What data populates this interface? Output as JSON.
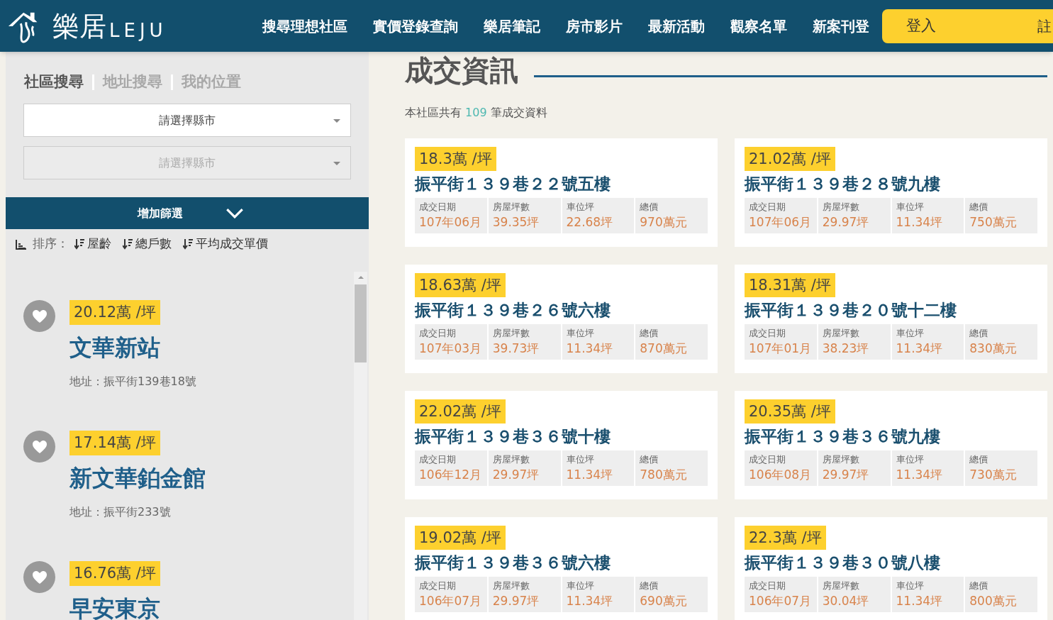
{
  "header": {
    "logo_text": "樂居",
    "logo_latin": "LEJU",
    "nav": [
      "搜尋理想社區",
      "實價登錄查詢",
      "樂居筆記",
      "房市影片",
      "最新活動",
      "觀察名單",
      "新案刊登"
    ],
    "login": "登入",
    "register": "註"
  },
  "sidebar": {
    "tabs": [
      {
        "label": "社區搜尋",
        "selected": true
      },
      {
        "label": "地址搜尋",
        "selected": false
      },
      {
        "label": "我的位置",
        "selected": false
      }
    ],
    "selects": [
      {
        "placeholder": "請選擇縣市",
        "disabled": false
      },
      {
        "placeholder": "請選擇縣市",
        "disabled": true
      }
    ],
    "filter_button": "增加篩選",
    "sort_label": "排序：",
    "sort_options": [
      "屋齡",
      "總戶數",
      "平均成交單價"
    ],
    "communities": [
      {
        "price": "20.12萬 /坪",
        "name": "文華新站",
        "address": "地址：振平街139巷18號"
      },
      {
        "price": "17.14萬 /坪",
        "name": "新文華鉑金館",
        "address": "地址：振平街233號"
      },
      {
        "price": "16.76萬 /坪",
        "name": "早安東京"
      }
    ]
  },
  "main": {
    "title": "成交資訊",
    "summary_before": "本社區共有",
    "summary_count": "109",
    "summary_after": "筆成交資料",
    "deals": [
      {
        "price": "18.3萬 /坪",
        "address": "振平街１３９巷２２號五樓",
        "fields": [
          {
            "label": "成交日期",
            "value": "107年06月"
          },
          {
            "label": "房屋坪數",
            "value": "39.35坪"
          },
          {
            "label": "車位坪",
            "value": "22.68坪"
          },
          {
            "label": "總價",
            "value": "970萬元"
          }
        ]
      },
      {
        "price": "21.02萬 /坪",
        "address": "振平街１３９巷２８號九樓",
        "fields": [
          {
            "label": "成交日期",
            "value": "107年06月"
          },
          {
            "label": "房屋坪數",
            "value": "29.97坪"
          },
          {
            "label": "車位坪",
            "value": "11.34坪"
          },
          {
            "label": "總價",
            "value": "750萬元"
          }
        ]
      },
      {
        "price": "18.63萬 /坪",
        "address": "振平街１３９巷２６號六樓",
        "fields": [
          {
            "label": "成交日期",
            "value": "107年03月"
          },
          {
            "label": "房屋坪數",
            "value": "39.73坪"
          },
          {
            "label": "車位坪",
            "value": "11.34坪"
          },
          {
            "label": "總價",
            "value": "870萬元"
          }
        ]
      },
      {
        "price": "18.31萬 /坪",
        "address": "振平街１３９巷２０號十二樓",
        "fields": [
          {
            "label": "成交日期",
            "value": "107年01月"
          },
          {
            "label": "房屋坪數",
            "value": "38.23坪"
          },
          {
            "label": "車位坪",
            "value": "11.34坪"
          },
          {
            "label": "總價",
            "value": "830萬元"
          }
        ]
      },
      {
        "price": "22.02萬 /坪",
        "address": "振平街１３９巷３６號十樓",
        "fields": [
          {
            "label": "成交日期",
            "value": "106年12月"
          },
          {
            "label": "房屋坪數",
            "value": "29.97坪"
          },
          {
            "label": "車位坪",
            "value": "11.34坪"
          },
          {
            "label": "總價",
            "value": "780萬元"
          }
        ]
      },
      {
        "price": "20.35萬 /坪",
        "address": "振平街１３９巷３６號九樓",
        "fields": [
          {
            "label": "成交日期",
            "value": "106年08月"
          },
          {
            "label": "房屋坪數",
            "value": "29.97坪"
          },
          {
            "label": "車位坪",
            "value": "11.34坪"
          },
          {
            "label": "總價",
            "value": "730萬元"
          }
        ]
      },
      {
        "price": "19.02萬 /坪",
        "address": "振平街１３９巷３６號六樓",
        "fields": [
          {
            "label": "成交日期",
            "value": "106年07月"
          },
          {
            "label": "房屋坪數",
            "value": "29.97坪"
          },
          {
            "label": "車位坪",
            "value": "11.34坪"
          },
          {
            "label": "總價",
            "value": "690萬元"
          }
        ]
      },
      {
        "price": "22.3萬 /坪",
        "address": "振平街１３９巷３０號八樓",
        "fields": [
          {
            "label": "成交日期",
            "value": "106年07月"
          },
          {
            "label": "房屋坪數",
            "value": "30.04坪"
          },
          {
            "label": "車位坪",
            "value": "11.34坪"
          },
          {
            "label": "總價",
            "value": "800萬元"
          }
        ]
      }
    ]
  }
}
